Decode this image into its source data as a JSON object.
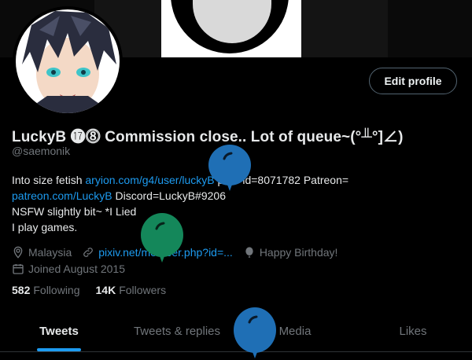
{
  "profile": {
    "edit_label": "Edit profile",
    "display_name": "LuckyB ⓱⓼ Commission close.. Lot of queue~(°╨°]∠)",
    "handle": "@saemonik"
  },
  "bio": {
    "line1_text": "Into size fetish ",
    "line1_link": "aryion.com/g4/user/luckyB",
    "line1_rest": " pixiv id=8071782 Patreon=",
    "line2_link": "patreon.com/LuckyB",
    "line2_rest": " Discord=LuckyB#9206",
    "line3": "NSFW slightly bit~ *I Lied",
    "line4": "I play games."
  },
  "meta": {
    "location": "Malaysia",
    "website": "pixiv.net/member.php?id=...",
    "birthday": "Happy Birthday!",
    "joined": "Joined August 2015"
  },
  "stats": {
    "following_count": "582",
    "following_label": "Following",
    "followers_count": "14K",
    "followers_label": "Followers"
  },
  "tabs": [
    {
      "label": "Tweets"
    },
    {
      "label": "Tweets & replies"
    },
    {
      "label": "Media"
    },
    {
      "label": "Likes"
    }
  ],
  "colors": {
    "accent": "#1d9bf0",
    "balloon_blue": "#1f6fb5",
    "balloon_green": "#14875a"
  }
}
